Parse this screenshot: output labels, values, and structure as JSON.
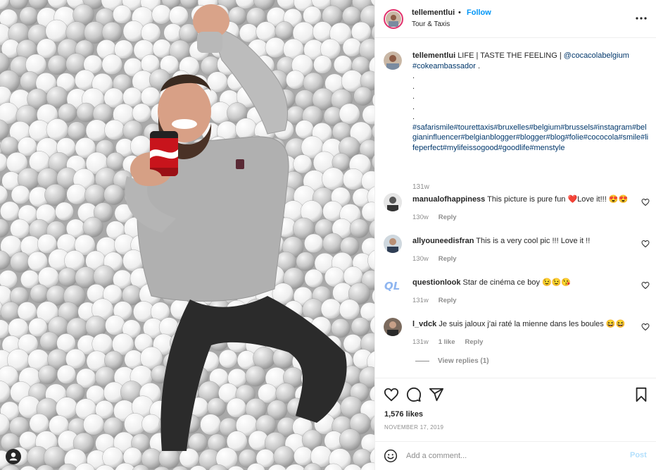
{
  "header": {
    "username": "tellementlui",
    "separator": "•",
    "follow_label": "Follow",
    "location": "Tour & Taxis"
  },
  "caption": {
    "username": "tellementlui",
    "text": "LIFE | TASTE THE FEELING |",
    "mention": "@cocacolabelgium",
    "hashtag1": "#cokeambassador",
    "after_hashtag1": ".",
    "dots": [
      ".",
      ".",
      ".",
      ".",
      "."
    ],
    "hashtags": "#safarismile#tourettaxis#bruxelles#belgium#brussels#instagram#belgianinfluencer#belgianblogger#blogger#blog#folie#cococola#smile#lifeperfect#mylifeissogood#goodlife#menstyle",
    "time": "131w"
  },
  "comments": [
    {
      "username": "manualofhappiness",
      "text": "This picture is pure fun ❤️Love it!!! 😍😍",
      "time": "130w",
      "likes": "",
      "reply": "Reply"
    },
    {
      "username": "allyouneedisfran",
      "text": "This is a very cool pic !!! Love it !!",
      "time": "130w",
      "likes": "",
      "reply": "Reply"
    },
    {
      "username": "questionlook",
      "text": "Star de cinéma ce boy 😉😉😘",
      "time": "131w",
      "likes": "",
      "reply": "Reply",
      "avatar_text": "QL"
    },
    {
      "username": "l_vdck",
      "text": "Je suis jaloux j'ai raté la mienne dans les boules 😆😆",
      "time": "131w",
      "likes": "1 like",
      "reply": "Reply"
    }
  ],
  "view_replies": "View replies (1)",
  "likes": "1,576 likes",
  "date": "NOVEMBER 17, 2019",
  "add_comment": {
    "placeholder": "Add a comment...",
    "post_label": "Post"
  },
  "colors": {
    "link": "#00376b",
    "follow": "#0095f6",
    "post_disabled": "#b2dffc",
    "muted": "#8e8e8e"
  },
  "icons": [
    "more-icon",
    "heart-icon",
    "comment-icon",
    "share-icon",
    "bookmark-icon",
    "emoji-icon",
    "user-tag-icon"
  ]
}
